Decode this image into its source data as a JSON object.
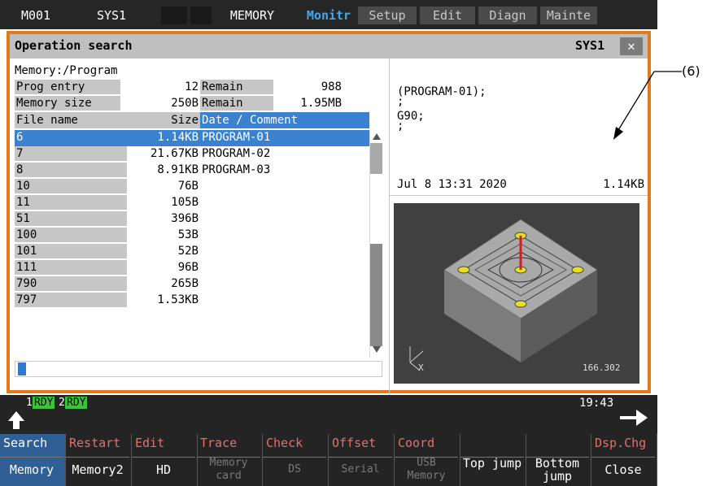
{
  "topbar": {
    "system_id": "M001",
    "system_name": "SYS1",
    "mode": "MEMORY",
    "tabs": [
      "Monitr",
      "Setup",
      "Edit",
      "Diagn",
      "Mainte"
    ]
  },
  "window": {
    "title": "Operation search",
    "system": "SYS1",
    "close_label": "✕"
  },
  "left": {
    "path": "Memory:/Program",
    "prog_entry_label": "Prog entry",
    "prog_entry_value": "12",
    "remain_label_1": "Remain",
    "remain_value_1": "988",
    "memory_size_label": "Memory size",
    "memory_size_value": "250B",
    "remain_label_2": "Remain",
    "remain_value_2": "1.95MB",
    "columns": {
      "file_name": "File name",
      "size": "Size",
      "date_comment": "Date / Comment"
    },
    "files": [
      {
        "name": "6",
        "size": "1.14KB",
        "comment": "PROGRAM-01"
      },
      {
        "name": "7",
        "size": "21.67KB",
        "comment": "PROGRAM-02"
      },
      {
        "name": "8",
        "size": "8.91KB",
        "comment": "PROGRAM-03"
      },
      {
        "name": "10",
        "size": "76B",
        "comment": ""
      },
      {
        "name": "11",
        "size": "105B",
        "comment": ""
      },
      {
        "name": "51",
        "size": "396B",
        "comment": ""
      },
      {
        "name": "100",
        "size": "53B",
        "comment": ""
      },
      {
        "name": "101",
        "size": "52B",
        "comment": ""
      },
      {
        "name": "111",
        "size": "96B",
        "comment": ""
      },
      {
        "name": "790",
        "size": "265B",
        "comment": ""
      },
      {
        "name": "797",
        "size": "1.53KB",
        "comment": ""
      }
    ]
  },
  "preview": {
    "lines": [
      "(PROGRAM-01);",
      ";",
      "G90;",
      ";"
    ],
    "date": "Jul  8 13:31 2020",
    "size": "1.14KB",
    "axis_label": "X",
    "zoom_value": "166.302"
  },
  "status": {
    "rdy1_num": "1",
    "rdy1": "RDY",
    "rdy2_num": "2",
    "rdy2": "RDY",
    "time": "19:43",
    "back_icon": "up-arrow-icon",
    "next_icon": "right-arrow-icon"
  },
  "function_keys": {
    "upper": [
      "Search",
      "Restart",
      "Edit",
      "Trace",
      "Check",
      "Offset",
      "Coord",
      "",
      "",
      "Dsp.Chg"
    ],
    "lower": [
      "Memory",
      "Memory2",
      "HD",
      "Memory card",
      "DS",
      "Serial",
      "USB Memory",
      "Top jump",
      "Bottom jump",
      "Close"
    ]
  },
  "annotation": {
    "label": "(6)"
  },
  "colors": {
    "accent_orange": "#e07a1e",
    "select_blue": "#3a82d0",
    "header_gray": "#bfbfbf",
    "panel_dark": "#242424",
    "upper_key_red": "#e07070",
    "rdy_green": "#3cc23c"
  }
}
